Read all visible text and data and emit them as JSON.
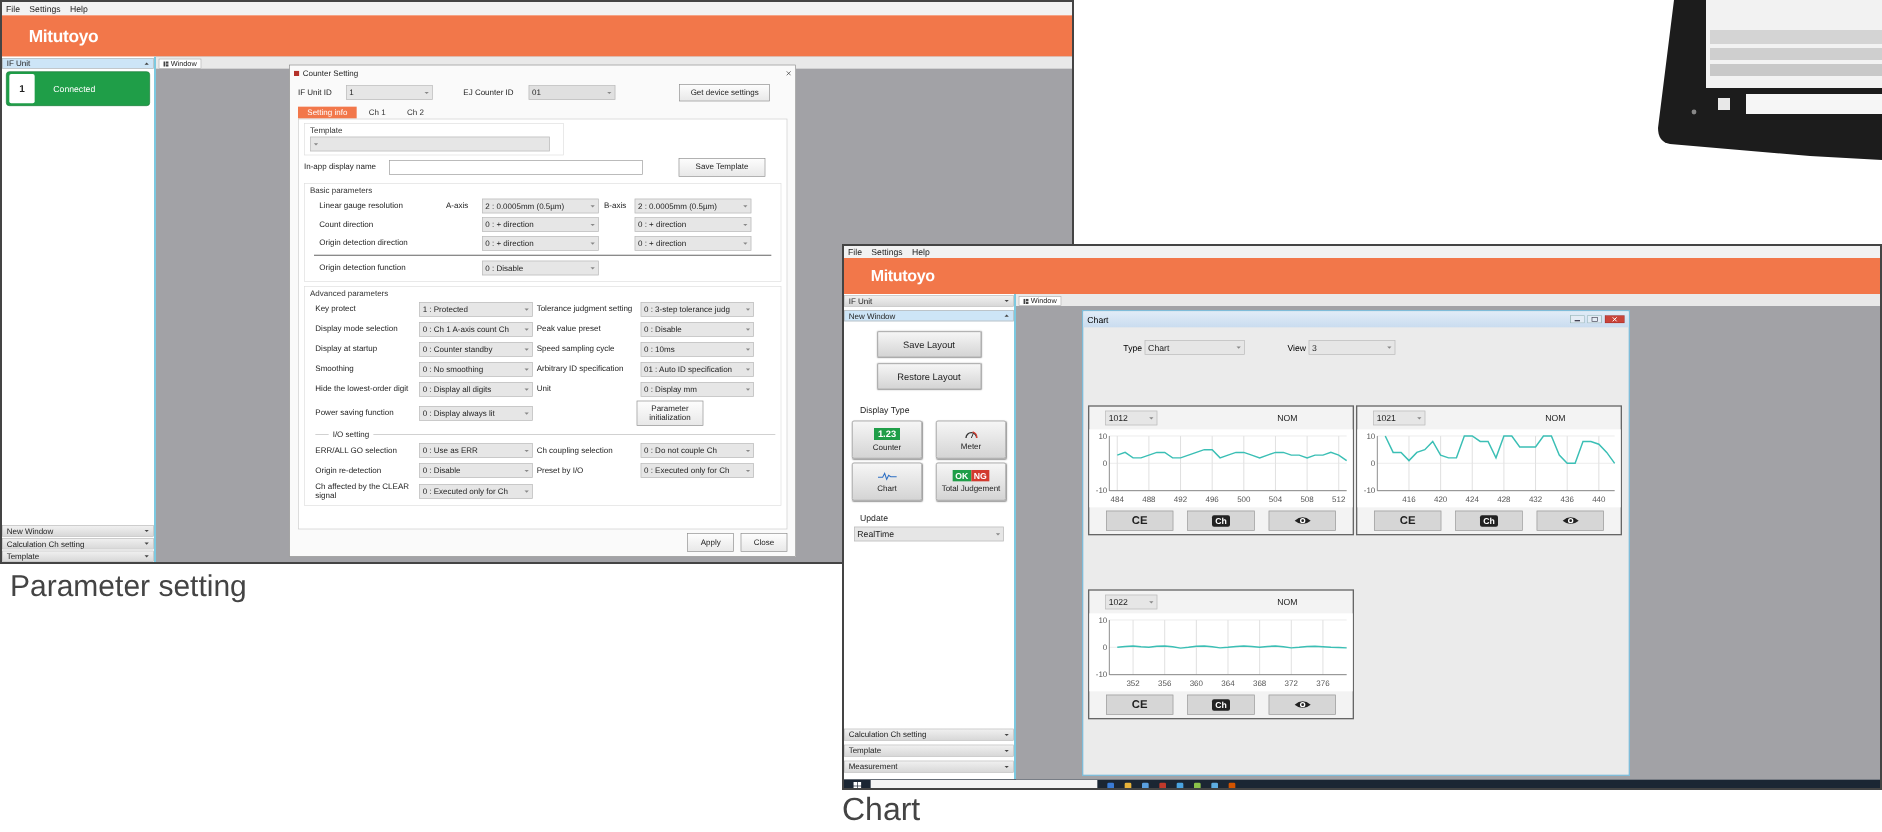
{
  "parameter_screen": {
    "menu": [
      "File",
      "Settings",
      "Help"
    ],
    "logo": "Mitutoyo",
    "sidebar": {
      "top": [
        {
          "label": "IF Unit",
          "expanded": true
        }
      ],
      "units": [
        {
          "number": "1",
          "status": "Connected"
        }
      ],
      "bottom": [
        {
          "label": "New Window",
          "expanded": false
        },
        {
          "label": "Calculation Ch setting",
          "expanded": false
        },
        {
          "label": "Template",
          "expanded": false
        }
      ]
    },
    "window_tab": "Window",
    "dialog": {
      "title": "Counter Setting",
      "if_unit_label": "IF Unit ID",
      "if_unit_value": "1",
      "counter_label": "EJ Counter ID",
      "counter_value": "01",
      "device_button": "Get device settings",
      "tabs": [
        {
          "label": "Setting info",
          "selected": true
        },
        {
          "label": "Ch 1",
          "selected": false
        },
        {
          "label": "Ch 2",
          "selected": false
        }
      ],
      "template_legend": "Template",
      "display_name_label": "In-app display name",
      "save_template": "Save Template",
      "basic": {
        "legend": "Basic parameters",
        "a_axis": "A-axis",
        "b_axis": "B-axis",
        "rows": [
          {
            "label": "Linear gauge resolution",
            "a": "2 : 0.0005mm (0.5µm)",
            "b": "2 : 0.0005mm (0.5µm)"
          },
          {
            "label": "Count direction",
            "a": "0 : + direction",
            "b": "0 : + direction"
          },
          {
            "label": "Origin detection direction",
            "a": "0 : + direction",
            "b": "0 : + direction"
          }
        ],
        "function_label": "Origin detection function",
        "function_value": "0 : Disable"
      },
      "advanced": {
        "legend": "Advanced parameters",
        "rows": [
          {
            "kind": "pair",
            "label": "Key protect",
            "value": "1 : Protected",
            "label_2": "Tolerance judgment setting",
            "value_2": "0 : 3-step tolerance judg"
          },
          {
            "kind": "pair",
            "label": "Display mode selection",
            "value": "0 : Ch 1 A-axis count Ch",
            "label_2": "Peak value preset",
            "value_2": "0 : Disable"
          },
          {
            "kind": "pair",
            "label": "Display at startup",
            "value": "0 : Counter standby",
            "label_2": "Speed sampling cycle",
            "value_2": "0 : 10ms"
          },
          {
            "kind": "pair",
            "label": "Smoothing",
            "value": "0 : No smoothing",
            "label_2": "Arbitrary ID specification",
            "value_2": "01 : Auto ID specification"
          },
          {
            "kind": "pair",
            "label": "Hide the lowest-order digit",
            "value": "0 : Display all digits",
            "label_2": "Unit",
            "value_2": "0 : Display mm"
          },
          {
            "kind": "button",
            "label": "Power saving function",
            "value": "0 : Display always lit",
            "button": "Parameter initialization"
          }
        ],
        "io_legend": "I/O setting",
        "io_rows": [
          {
            "kind": "pair",
            "label": "ERR/ALL GO selection",
            "value": "0 : Use as ERR",
            "label_2": "Ch coupling selection",
            "value_2": "0 : Do not couple Ch"
          },
          {
            "kind": "pair",
            "label": "Origin re-detection",
            "value": "0 : Disable",
            "label_2": "Preset by I/O",
            "value_2": "0 : Executed only for Ch"
          },
          {
            "kind": "single",
            "label": "Ch affected by the CLEAR signal",
            "value": "0 : Executed only for Ch"
          }
        ]
      },
      "buttons": [
        "Apply",
        "Close"
      ]
    }
  },
  "parameter_caption": "Parameter setting",
  "chart_screen": {
    "menu": [
      "File",
      "Settings",
      "Help"
    ],
    "logo": "Mitutoyo",
    "sidebar": {
      "top": [
        {
          "label": "IF Unit",
          "expanded": false
        },
        {
          "label": "New Window",
          "expanded": true
        }
      ],
      "layout_buttons": [
        "Save Layout",
        "Restore Layout"
      ],
      "display_type_label": "Display Type",
      "display_types": [
        {
          "kind": "counter",
          "label": "Counter",
          "display": "1.23"
        },
        {
          "kind": "meter",
          "label": "Meter"
        },
        {
          "kind": "chart",
          "label": "Chart"
        },
        {
          "kind": "judgement",
          "label": "Total Judgement",
          "ok": "OK",
          "ng": "NG"
        }
      ],
      "update_label": "Update",
      "update_value": "RealTime",
      "bottom": [
        {
          "label": "Calculation Ch setting",
          "expanded": false
        },
        {
          "label": "Template",
          "expanded": false
        },
        {
          "label": "Measurement",
          "expanded": false
        }
      ]
    },
    "window_tab": "Window",
    "chart_window": {
      "title": "Chart",
      "type_label": "Type",
      "type_value": "Chart",
      "view_label": "View",
      "view_value": "3",
      "panels": [
        {
          "channel": "1012",
          "mode": "NOM",
          "buttons": [
            {
              "kind": "text",
              "label": "CE"
            },
            {
              "kind": "badge",
              "label": "Ch"
            },
            {
              "kind": "eye"
            }
          ],
          "chart_data": {
            "type": "line",
            "grid": true,
            "x": [
              484,
              485,
              486,
              487,
              488,
              489,
              490,
              491,
              492,
              493,
              494,
              495,
              496,
              497,
              498,
              499,
              500,
              501,
              502,
              503,
              504,
              505,
              506,
              507,
              508,
              509,
              510,
              511,
              512,
              513
            ],
            "xlim": [
              483,
              513
            ],
            "ylim": [
              -10,
              10
            ],
            "xticks": [
              484,
              488,
              492,
              496,
              500,
              504,
              508,
              512
            ],
            "yticks": [
              -10,
              0,
              10
            ],
            "series": [
              {
                "color": "#3bbfb5",
                "values": [
                  3,
                  4,
                  2,
                  2,
                  3,
                  4,
                  4,
                  2,
                  2,
                  3,
                  4,
                  5,
                  5,
                  2,
                  3,
                  4,
                  4,
                  3,
                  2,
                  3,
                  4,
                  4,
                  3,
                  3,
                  2,
                  3,
                  3,
                  4,
                  3,
                  1
                ]
              }
            ]
          }
        },
        {
          "channel": "1021",
          "mode": "NOM",
          "buttons": [
            {
              "kind": "text",
              "label": "CE"
            },
            {
              "kind": "badge",
              "label": "Ch"
            },
            {
              "kind": "eye"
            }
          ],
          "chart_data": {
            "type": "line",
            "grid": true,
            "x": [
              413,
              414,
              415,
              416,
              417,
              418,
              419,
              420,
              421,
              422,
              423,
              424,
              425,
              426,
              427,
              428,
              429,
              430,
              431,
              432,
              433,
              434,
              435,
              436,
              437,
              438,
              439,
              440,
              441,
              442
            ],
            "xlim": [
              412,
              442
            ],
            "ylim": [
              -10,
              10
            ],
            "xticks": [
              416,
              420,
              424,
              428,
              432,
              436,
              440
            ],
            "yticks": [
              -10,
              0,
              10
            ],
            "series": [
              {
                "color": "#3bbfb5",
                "values": [
                  10,
                  4,
                  4,
                  1,
                  4,
                  5,
                  8,
                  3,
                  2,
                  2,
                  10,
                  10,
                  8,
                  8,
                  2,
                  10,
                  10,
                  6,
                  6,
                  6,
                  10,
                  10,
                  3,
                  0,
                  0,
                  8,
                  8,
                  7,
                  4,
                  0
                ]
              }
            ]
          }
        },
        {
          "channel": "1022",
          "mode": "NOM",
          "buttons": [
            {
              "kind": "text",
              "label": "CE"
            },
            {
              "kind": "badge",
              "label": "Ch"
            },
            {
              "kind": "eye"
            }
          ],
          "chart_data": {
            "type": "line",
            "grid": true,
            "x": [
              350,
              351,
              352,
              353,
              354,
              355,
              356,
              357,
              358,
              359,
              360,
              361,
              362,
              363,
              364,
              365,
              366,
              367,
              368,
              369,
              370,
              371,
              372,
              373,
              374,
              375,
              376,
              377,
              378,
              379
            ],
            "xlim": [
              349,
              379
            ],
            "ylim": [
              -10,
              10
            ],
            "xticks": [
              352,
              356,
              360,
              364,
              368,
              372,
              376
            ],
            "yticks": [
              -10,
              0,
              10
            ],
            "series": [
              {
                "color": "#3bbfb5",
                "values": [
                  0,
                  0.3,
                  0.5,
                  0.2,
                  0,
                  0.4,
                  0.5,
                  0.2,
                  -0.3,
                  0,
                  0.4,
                  0.5,
                  0.2,
                  -0.2,
                  0,
                  0.3,
                  0.5,
                  0.3,
                  0,
                  0.3,
                  0.5,
                  0.2,
                  -0.2,
                  0,
                  0.3,
                  0.4,
                  0.2,
                  0,
                  -0.1,
                  -0.2
                ]
              }
            ]
          }
        }
      ]
    }
  },
  "chart_caption": "Chart"
}
